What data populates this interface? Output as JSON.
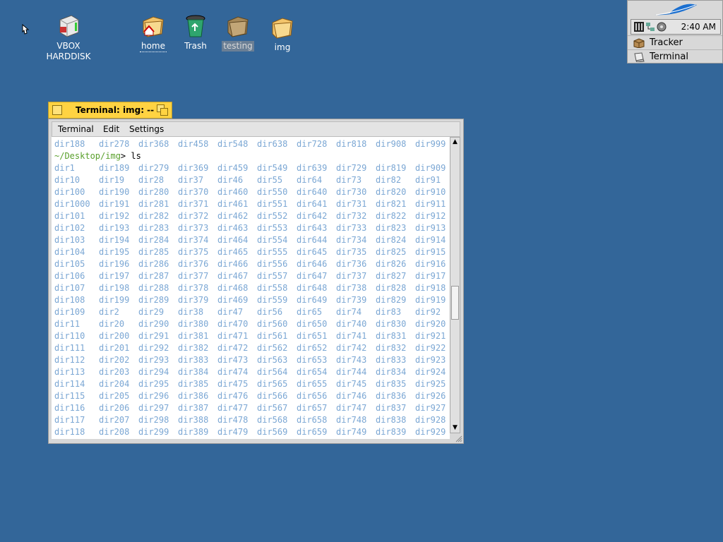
{
  "desktop": {
    "icons": [
      {
        "label": "VBOX HARDDISK",
        "icon": "harddisk-icon"
      },
      {
        "label": "home",
        "icon": "home-folder-icon"
      },
      {
        "label": "Trash",
        "icon": "trash-icon"
      },
      {
        "label": "testing",
        "icon": "folder-icon"
      },
      {
        "label": "img",
        "icon": "folder-icon"
      }
    ]
  },
  "deskbar": {
    "clock": "2:40 AM",
    "apps": [
      {
        "label": "Tracker",
        "icon": "tracker-icon"
      },
      {
        "label": "Terminal",
        "icon": "terminal-icon"
      }
    ]
  },
  "terminal_window": {
    "title": "Terminal: img: --",
    "menu": [
      "Terminal",
      "Edit",
      "Settings"
    ],
    "top_line": [
      "dir188",
      "dir278",
      "dir368",
      "dir458",
      "dir548",
      "dir638",
      "dir728",
      "dir818",
      "dir908",
      "dir999"
    ],
    "prompt_path": "~/Desktop/img",
    "prompt_rest": "> ls",
    "rows": [
      [
        "dir1",
        "dir189",
        "dir279",
        "dir369",
        "dir459",
        "dir549",
        "dir639",
        "dir729",
        "dir819",
        "dir909"
      ],
      [
        "dir10",
        "dir19",
        "dir28",
        "dir37",
        "dir46",
        "dir55",
        "dir64",
        "dir73",
        "dir82",
        "dir91"
      ],
      [
        "dir100",
        "dir190",
        "dir280",
        "dir370",
        "dir460",
        "dir550",
        "dir640",
        "dir730",
        "dir820",
        "dir910"
      ],
      [
        "dir1000",
        "dir191",
        "dir281",
        "dir371",
        "dir461",
        "dir551",
        "dir641",
        "dir731",
        "dir821",
        "dir911"
      ],
      [
        "dir101",
        "dir192",
        "dir282",
        "dir372",
        "dir462",
        "dir552",
        "dir642",
        "dir732",
        "dir822",
        "dir912"
      ],
      [
        "dir102",
        "dir193",
        "dir283",
        "dir373",
        "dir463",
        "dir553",
        "dir643",
        "dir733",
        "dir823",
        "dir913"
      ],
      [
        "dir103",
        "dir194",
        "dir284",
        "dir374",
        "dir464",
        "dir554",
        "dir644",
        "dir734",
        "dir824",
        "dir914"
      ],
      [
        "dir104",
        "dir195",
        "dir285",
        "dir375",
        "dir465",
        "dir555",
        "dir645",
        "dir735",
        "dir825",
        "dir915"
      ],
      [
        "dir105",
        "dir196",
        "dir286",
        "dir376",
        "dir466",
        "dir556",
        "dir646",
        "dir736",
        "dir826",
        "dir916"
      ],
      [
        "dir106",
        "dir197",
        "dir287",
        "dir377",
        "dir467",
        "dir557",
        "dir647",
        "dir737",
        "dir827",
        "dir917"
      ],
      [
        "dir107",
        "dir198",
        "dir288",
        "dir378",
        "dir468",
        "dir558",
        "dir648",
        "dir738",
        "dir828",
        "dir918"
      ],
      [
        "dir108",
        "dir199",
        "dir289",
        "dir379",
        "dir469",
        "dir559",
        "dir649",
        "dir739",
        "dir829",
        "dir919"
      ],
      [
        "dir109",
        "dir2",
        "dir29",
        "dir38",
        "dir47",
        "dir56",
        "dir65",
        "dir74",
        "dir83",
        "dir92"
      ],
      [
        "dir11",
        "dir20",
        "dir290",
        "dir380",
        "dir470",
        "dir560",
        "dir650",
        "dir740",
        "dir830",
        "dir920"
      ],
      [
        "dir110",
        "dir200",
        "dir291",
        "dir381",
        "dir471",
        "dir561",
        "dir651",
        "dir741",
        "dir831",
        "dir921"
      ],
      [
        "dir111",
        "dir201",
        "dir292",
        "dir382",
        "dir472",
        "dir562",
        "dir652",
        "dir742",
        "dir832",
        "dir922"
      ],
      [
        "dir112",
        "dir202",
        "dir293",
        "dir383",
        "dir473",
        "dir563",
        "dir653",
        "dir743",
        "dir833",
        "dir923"
      ],
      [
        "dir113",
        "dir203",
        "dir294",
        "dir384",
        "dir474",
        "dir564",
        "dir654",
        "dir744",
        "dir834",
        "dir924"
      ],
      [
        "dir114",
        "dir204",
        "dir295",
        "dir385",
        "dir475",
        "dir565",
        "dir655",
        "dir745",
        "dir835",
        "dir925"
      ],
      [
        "dir115",
        "dir205",
        "dir296",
        "dir386",
        "dir476",
        "dir566",
        "dir656",
        "dir746",
        "dir836",
        "dir926"
      ],
      [
        "dir116",
        "dir206",
        "dir297",
        "dir387",
        "dir477",
        "dir567",
        "dir657",
        "dir747",
        "dir837",
        "dir927"
      ],
      [
        "dir117",
        "dir207",
        "dir298",
        "dir388",
        "dir478",
        "dir568",
        "dir658",
        "dir748",
        "dir838",
        "dir928"
      ],
      [
        "dir118",
        "dir208",
        "dir299",
        "dir389",
        "dir479",
        "dir569",
        "dir659",
        "dir749",
        "dir839",
        "dir929"
      ]
    ]
  },
  "colors": {
    "desktop": "#336699",
    "tab": "#ffd342",
    "listing_text": "#7ba7d4",
    "prompt_path": "#5aa02c"
  }
}
